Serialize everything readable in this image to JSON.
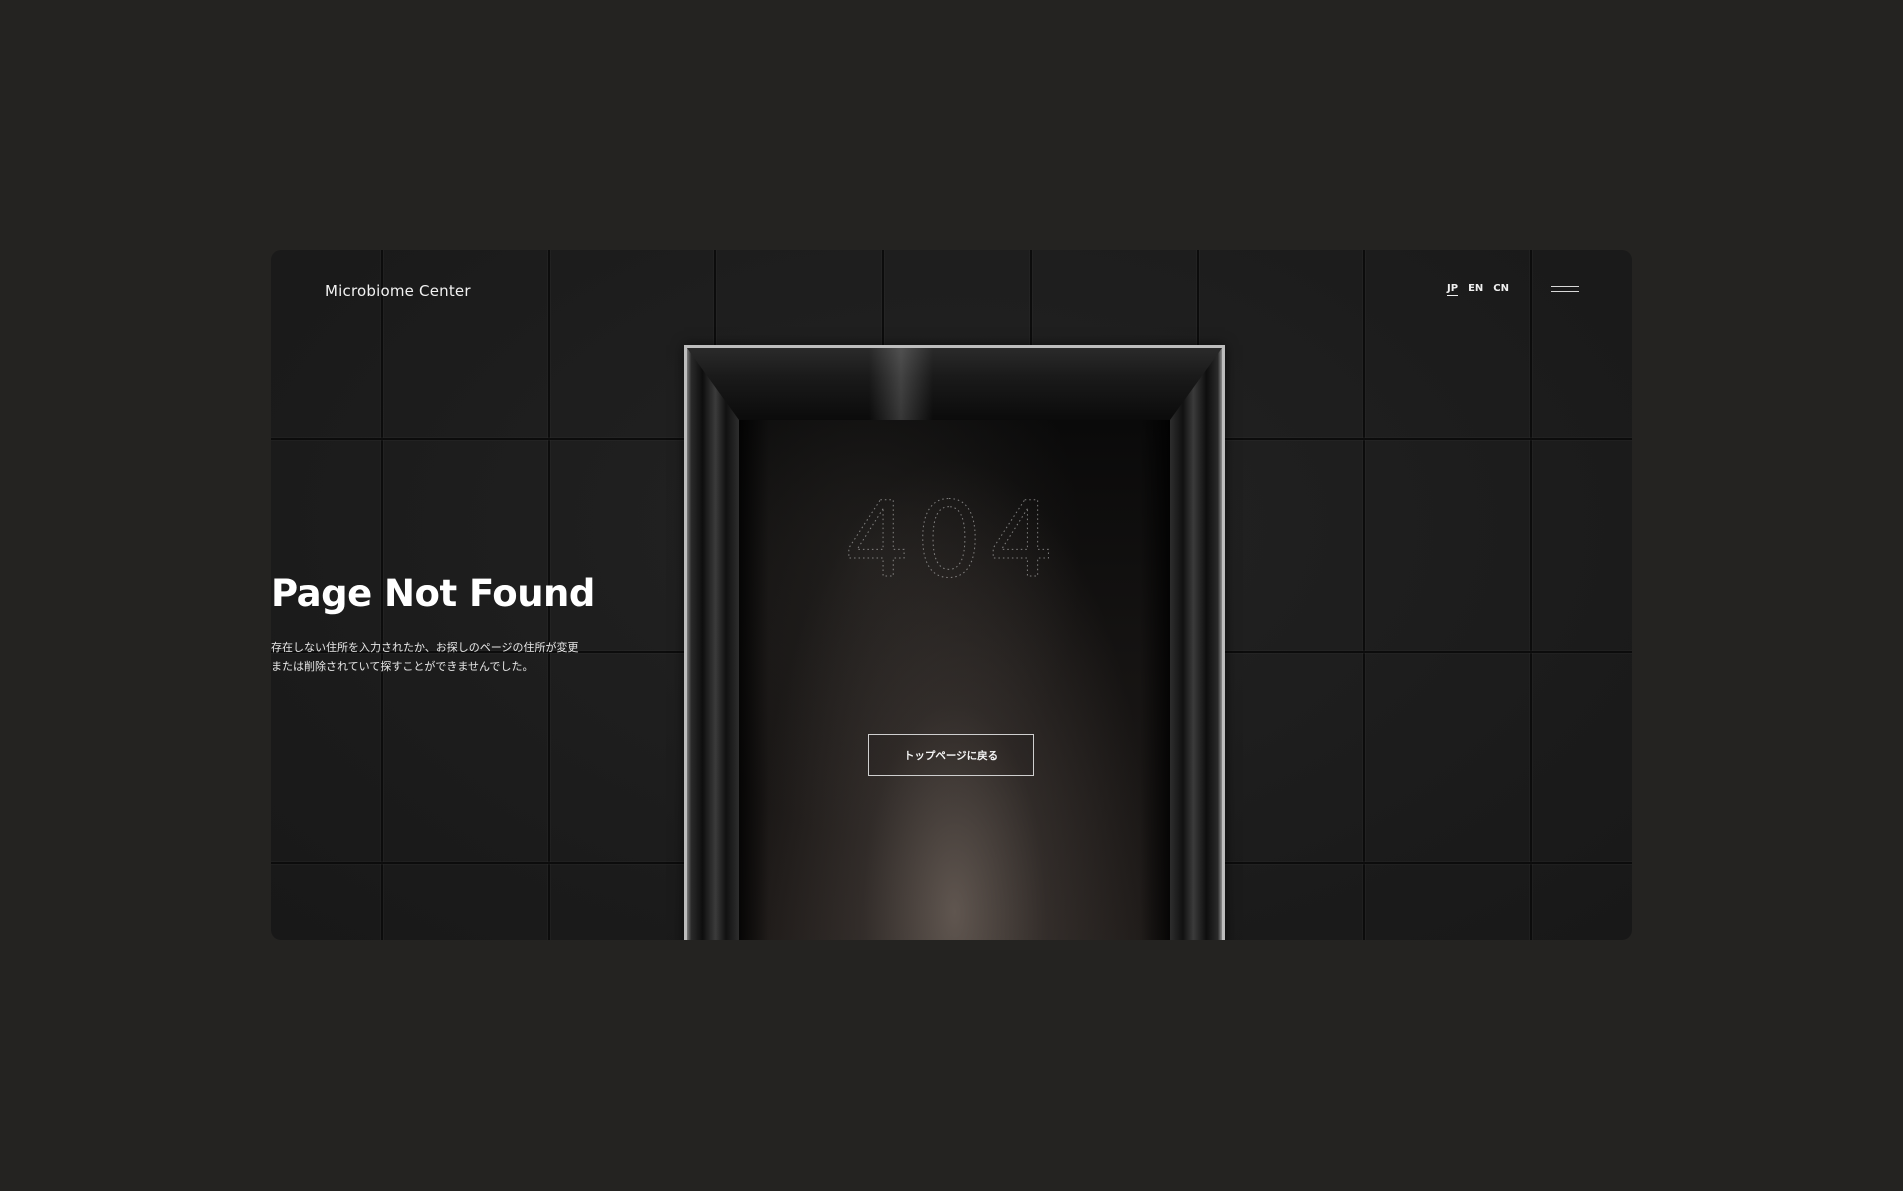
{
  "header": {
    "logo": "Microbiome Center",
    "languages": [
      "JP",
      "EN",
      "CN"
    ],
    "active_language": "JP",
    "menu_icon": "hamburger-icon"
  },
  "error": {
    "code": "404",
    "title": "Page Not Found",
    "description_line1": "存在しない住所を入力されたか、お探しのページの住所が変更",
    "description_line2": "または削除されていて探すことができませんでした。",
    "back_button_label": "トップページに戻る"
  },
  "colors": {
    "page_background": "#242321",
    "frame_background": "#1b1b1b",
    "text": "#ffffff"
  }
}
